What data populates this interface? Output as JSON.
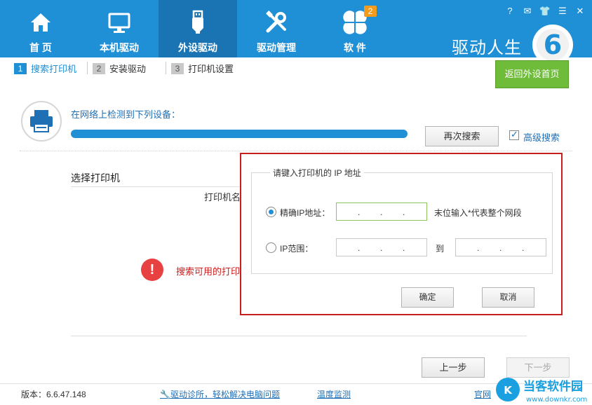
{
  "nav": {
    "items": [
      {
        "label": "首 页",
        "icon": "home-icon"
      },
      {
        "label": "本机驱动",
        "icon": "monitor-icon"
      },
      {
        "label": "外设驱动",
        "icon": "usb-icon"
      },
      {
        "label": "驱动管理",
        "icon": "tools-icon"
      },
      {
        "label": "软 件",
        "icon": "clover-icon"
      }
    ],
    "software_badge": "2",
    "brand": "驱动人生",
    "brand_number": "6"
  },
  "window_controls": [
    "?",
    "✉",
    "👕",
    "☰",
    "✕"
  ],
  "steps": [
    {
      "num": "1",
      "label": "搜索打印机"
    },
    {
      "num": "2",
      "label": "安装驱动"
    },
    {
      "num": "3",
      "label": "打印机设置"
    }
  ],
  "back_button": "返回外设首页",
  "detect": {
    "title": "在网络上检测到下列设备：",
    "progress": 1.0,
    "search_again": "再次搜索",
    "advanced_search": "高级搜索"
  },
  "list": {
    "choose_label": "选择打印机",
    "column_name": "打印机名",
    "error_text": "搜索可用的打印机"
  },
  "buttons": {
    "prev": "上一步",
    "next": "下一步"
  },
  "footer": {
    "version": "版本：6.6.47.148",
    "diagnose_link": "驱动诊所，轻松解决电脑问题",
    "temp_link": "温度监测",
    "site_link": "官网",
    "watermark": "当客软件园",
    "watermark_url": "www.downkr.com"
  },
  "dialog": {
    "group_title": "请键入打印机的 IP 地址",
    "exact_label": "精确IP地址：",
    "exact_hint": "末位输入*代表整个网段",
    "range_label": "IP范围：",
    "to_label": "到",
    "ok": "确定",
    "cancel": "取消"
  },
  "colors": {
    "accent": "#1f8fd6",
    "green": "#6fbb3a",
    "error": "#e84141",
    "highlight_border": "#c81e1e"
  }
}
